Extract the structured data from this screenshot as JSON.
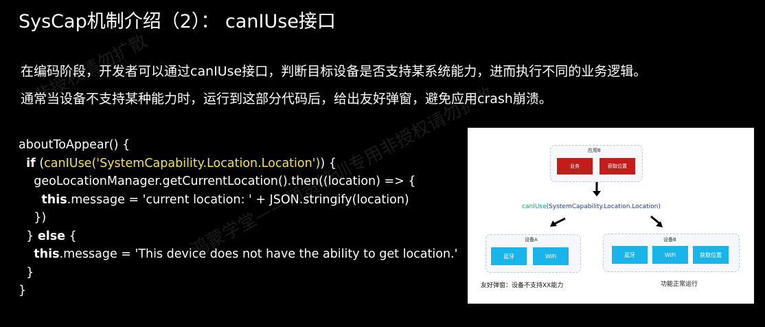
{
  "slide": {
    "title": "SysCap机制介绍（2）：  canIUse接口",
    "description": [
      "在编码阶段，开发者可以通过canIUse接口，判断目标设备是否支持某系统能力，进而执行不同的业务逻辑。",
      "通常当设备不支持某种能力时，运行到这部分代码后，给出友好弹窗，避免应用crash崩溃。"
    ],
    "watermarks": [
      "鸿蒙学堂——师资培训专用非授权请勿扩散",
      "非授权请勿扩散"
    ]
  },
  "code": {
    "line1": "aboutToAppear() {",
    "line2_kw": "if",
    "line2_open": " (",
    "line2_call": "canIUse('SystemCapability.Location.Location')",
    "line2_close": ") {",
    "line3": "geoLocationManager.getCurrentLocation().then((location) => {",
    "line4_kw": "this",
    "line4_rest": ".message = 'current location: ' + JSON.stringify(location)",
    "line5": "})",
    "line6_brace": "} ",
    "line6_kw": "else",
    "line6_rest": " {",
    "line7_kw": "this",
    "line7_rest": ".message = 'This device does not have the ability to get location.'",
    "line8": "}",
    "line9": "}"
  },
  "diagram": {
    "top_box": {
      "label": "应用B",
      "items": [
        "业务",
        "获取位置"
      ]
    },
    "call_prefix": "canIUse",
    "call_arg": "(SystemCapability.Location.Location)",
    "device_a": {
      "label": "设备A",
      "items": [
        "蓝牙",
        "WiFi"
      ]
    },
    "device_b": {
      "label": "设备B",
      "items": [
        "蓝牙",
        "WiFi",
        "获取位置"
      ]
    },
    "caption_left": "友好弹窗：设备不支持XX能力",
    "caption_right": "功能正常运行",
    "colors": {
      "red": "#c41b1b",
      "blue": "#19b4e9",
      "call_text": "#1a3a8a",
      "highlight": "#f5e14a"
    }
  }
}
